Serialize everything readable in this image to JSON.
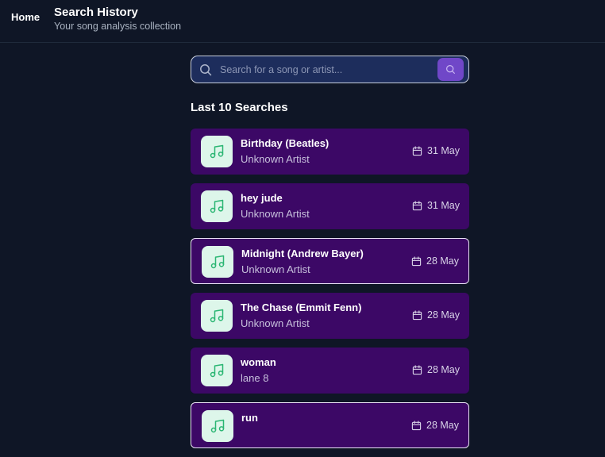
{
  "header": {
    "home_label": "Home",
    "title": "Search History",
    "subtitle": "Your song analysis collection"
  },
  "search": {
    "placeholder": "Search for a song or artist...",
    "value": ""
  },
  "section": {
    "heading": "Last 10 Searches"
  },
  "colors": {
    "background": "#0f1626",
    "card": "#3c0866",
    "accent": "#7047c8",
    "icon_tile": "#ddf6ea",
    "icon_green": "#2bb673"
  },
  "icons": {
    "song": "music-note-icon",
    "date": "calendar-icon",
    "search": "search-icon"
  },
  "history": [
    {
      "title": "Birthday (Beatles)",
      "artist": "Unknown Artist",
      "date": "31 May"
    },
    {
      "title": "hey jude",
      "artist": "Unknown Artist",
      "date": "31 May"
    },
    {
      "title": "Midnight (Andrew Bayer)",
      "artist": "Unknown Artist",
      "date": "28 May"
    },
    {
      "title": "The Chase (Emmit Fenn)",
      "artist": "Unknown Artist",
      "date": "28 May"
    },
    {
      "title": "woman",
      "artist": "lane 8",
      "date": "28 May"
    },
    {
      "title": "run",
      "artist": "",
      "date": "28 May"
    }
  ]
}
